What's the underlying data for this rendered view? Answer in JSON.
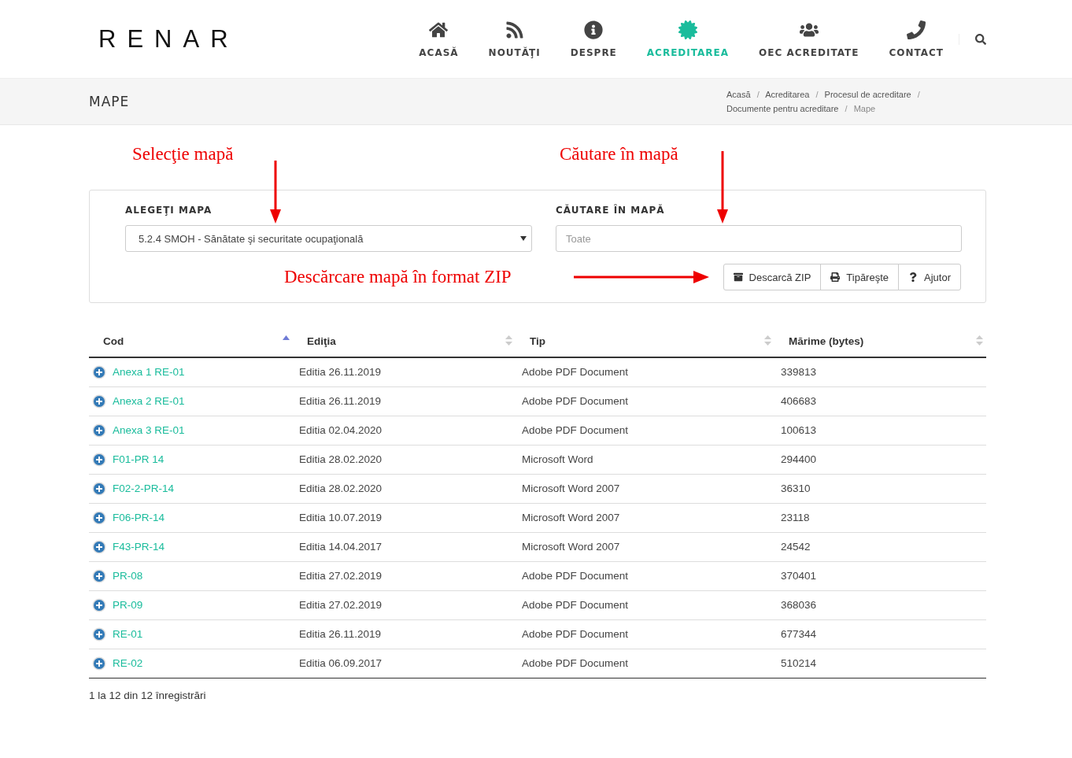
{
  "logo": "RENAR",
  "nav": [
    {
      "label": "ACASĂ",
      "selected": false
    },
    {
      "label": "NOUTĂŢI",
      "selected": false
    },
    {
      "label": "DESPRE",
      "selected": false
    },
    {
      "label": "ACREDITAREA",
      "selected": true
    },
    {
      "label": "OEC ACREDITATE",
      "selected": false
    },
    {
      "label": "CONTACT",
      "selected": false
    }
  ],
  "page_title": "MAPE",
  "breadcrumb": {
    "separator": "/",
    "items": [
      {
        "label": "Acasă",
        "current": false
      },
      {
        "label": "Acreditarea",
        "current": false
      },
      {
        "label": "Procesul de acreditare",
        "current": false
      },
      {
        "label": "Documente pentru acreditare",
        "current": false
      },
      {
        "label": "Mape",
        "current": true
      }
    ]
  },
  "annotations": {
    "select": "Selecţie mapă",
    "search": "Căutare în mapă",
    "download": "Descărcare mapă în format ZIP"
  },
  "filter": {
    "select_label": "ALEGEŢI MAPA",
    "select_value": "5.2.4 SMOH - Sănătate şi securitate ocupaţională",
    "search_label": "CĂUTARE ÎN MAPĂ",
    "search_placeholder": "Toate"
  },
  "buttons": [
    "Descarcă ZIP",
    "Tipăreşte",
    "Ajutor"
  ],
  "table": {
    "columns": [
      {
        "label": "Cod",
        "sorted": true
      },
      {
        "label": "Ediţia",
        "sorted": false
      },
      {
        "label": "Tip",
        "sorted": false
      },
      {
        "label": "Mărime (bytes)",
        "sorted": false
      }
    ],
    "rows": [
      [
        "Anexa 1 RE-01",
        "Editia 26.11.2019",
        "Adobe PDF Document",
        "339813"
      ],
      [
        "Anexa 2 RE-01",
        "Editia 26.11.2019",
        "Adobe PDF Document",
        "406683"
      ],
      [
        "Anexa 3 RE-01",
        "Editia 02.04.2020",
        "Adobe PDF Document",
        "100613"
      ],
      [
        "F01-PR 14",
        "Editia 28.02.2020",
        "Microsoft Word",
        "294400"
      ],
      [
        "F02-2-PR-14",
        "Editia 28.02.2020",
        "Microsoft Word 2007",
        "36310"
      ],
      [
        "F06-PR-14",
        "Editia 10.07.2019",
        "Microsoft Word 2007",
        "23118"
      ],
      [
        "F43-PR-14",
        "Editia 14.04.2017",
        "Microsoft Word 2007",
        "24542"
      ],
      [
        "PR-08",
        "Editia 27.02.2019",
        "Adobe PDF Document",
        "370401"
      ],
      [
        "PR-09",
        "Editia 27.02.2019",
        "Adobe PDF Document",
        "368036"
      ],
      [
        "RE-01",
        "Editia 26.11.2019",
        "Adobe PDF Document",
        "677344"
      ],
      [
        "RE-02",
        "Editia 06.09.2017",
        "Adobe PDF Document",
        "510214"
      ]
    ]
  },
  "footer": "1 la 12 din 12 înregistrări"
}
